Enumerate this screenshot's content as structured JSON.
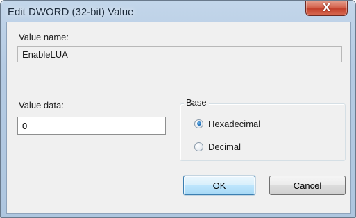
{
  "window": {
    "title": "Edit DWORD (32-bit) Value",
    "close_glyph": "X",
    "close_icon": "close-icon"
  },
  "fields": {
    "value_name_label": "Value name:",
    "value_name": "EnableLUA",
    "value_data_label": "Value data:",
    "value_data": "0"
  },
  "base": {
    "title": "Base",
    "options": [
      {
        "label": "Hexadecimal",
        "checked": true
      },
      {
        "label": "Decimal",
        "checked": false
      }
    ]
  },
  "buttons": {
    "ok_label": "OK",
    "cancel_label": "Cancel"
  },
  "colors": {
    "close_button": "#c9442e",
    "ok_button_border": "#3c7fb1",
    "radio_selected": "#1f6fb8"
  }
}
